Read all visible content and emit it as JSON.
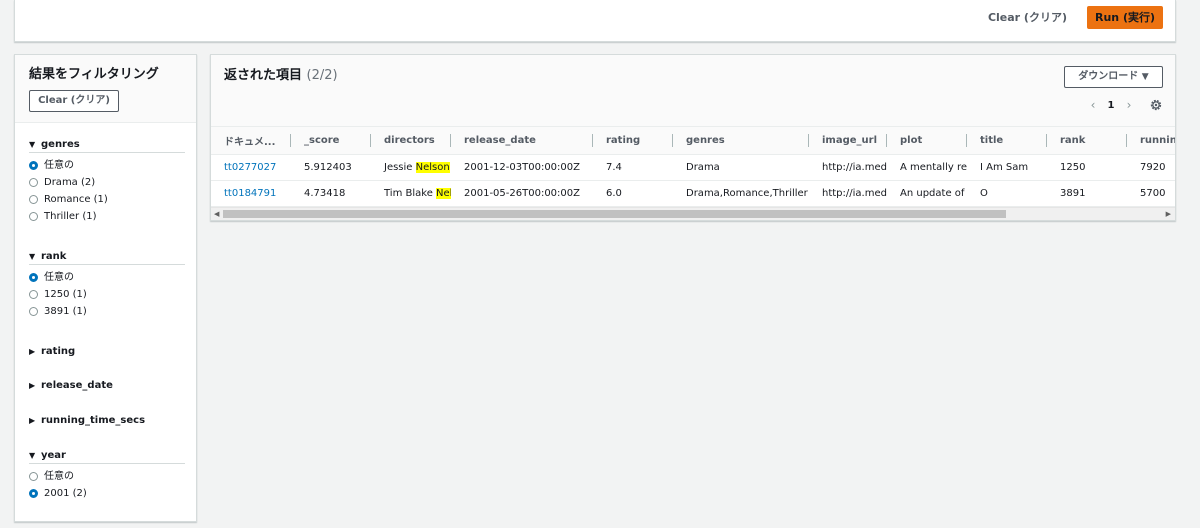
{
  "toolbar": {
    "clear_label": "Clear (クリア)",
    "run_label": "Run (実行)"
  },
  "filters": {
    "title": "結果をフィルタリング",
    "clear_label": "Clear (クリア)",
    "facets": {
      "genres": {
        "label": "genres",
        "options": [
          "任意の",
          "Drama (2)",
          "Romance (1)",
          "Thriller (1)"
        ]
      },
      "rank": {
        "label": "rank",
        "options": [
          "任意の",
          "1250 (1)",
          "3891 (1)"
        ]
      },
      "rating": {
        "label": "rating"
      },
      "release_date": {
        "label": "release_date"
      },
      "running_time_secs": {
        "label": "running_time_secs"
      },
      "year": {
        "label": "year",
        "options": [
          "任意の",
          "2001 (2)"
        ]
      }
    }
  },
  "results": {
    "title": "返された項目",
    "count": "(2/2)",
    "download_label": "ダウンロード",
    "page": "1",
    "columns": [
      "ドキュメ...",
      "_score",
      "directors",
      "release_date",
      "rating",
      "genres",
      "image_url",
      "plot",
      "title",
      "rank",
      "running"
    ],
    "rows": [
      {
        "id": "tt0277027",
        "score": "5.912403",
        "directors_pre": "Jessie ",
        "directors_hl": "Nelson",
        "release_date": "2001-12-03T00:00:00Z",
        "rating": "7.4",
        "genres": "Drama",
        "image_url": "http://ia.media",
        "plot": "A mentally retar",
        "title": "I Am Sam",
        "rank": "1250",
        "running": "7920"
      },
      {
        "id": "tt0184791",
        "score": "4.73418",
        "directors_pre": "Tim Blake ",
        "directors_hl": "Nelsc",
        "release_date": "2001-05-26T00:00:00Z",
        "rating": "6.0",
        "genres": "Drama,Romance,Thriller",
        "image_url": "http://ia.media",
        "plot": "An update of Sh",
        "title": "O",
        "rank": "3891",
        "running": "5700"
      }
    ]
  }
}
